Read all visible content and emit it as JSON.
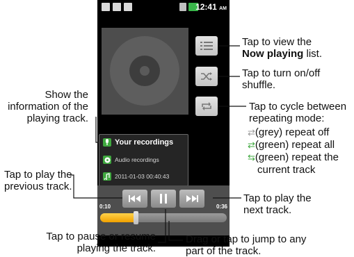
{
  "status": {
    "time": "12:41",
    "ampm": "AM"
  },
  "info": {
    "title": "Your recordings",
    "album": "Audio recordings",
    "date": "2011-01-03 00:40:43"
  },
  "controls": {
    "elapsed": "0:10",
    "duration": "0:36",
    "progress": 0.28
  },
  "annotations": {
    "now_playing_l1": "Tap to view the",
    "now_playing_bold": "Now playing",
    "now_playing_l2b": " list.",
    "shuffle_l1": "Tap to turn on/off",
    "shuffle_l2": "shuffle.",
    "repeat_l1": "Tap to cycle between",
    "repeat_l2": "repeating mode:",
    "repeat_off": "(grey) repeat off",
    "repeat_all": "(green) repeat all",
    "repeat_cur_l1": "(green) repeat the",
    "repeat_cur_l2": "current track",
    "info_l1": "Show the",
    "info_l2": "information of the",
    "info_l3": "playing track.",
    "prev_l1": "Tap to play the",
    "prev_l2": "previous track.",
    "next_l1": "Tap to play the",
    "next_l2": "next track.",
    "pause_l1": "Tap to pause or resume",
    "pause_l2": "playing the track.",
    "seek_l1": "Drag or tap to jump to any",
    "seek_l2": "part of the track."
  },
  "colors": {
    "accent": "#f5b400",
    "green": "#3fa83f",
    "grey": "#999999"
  }
}
